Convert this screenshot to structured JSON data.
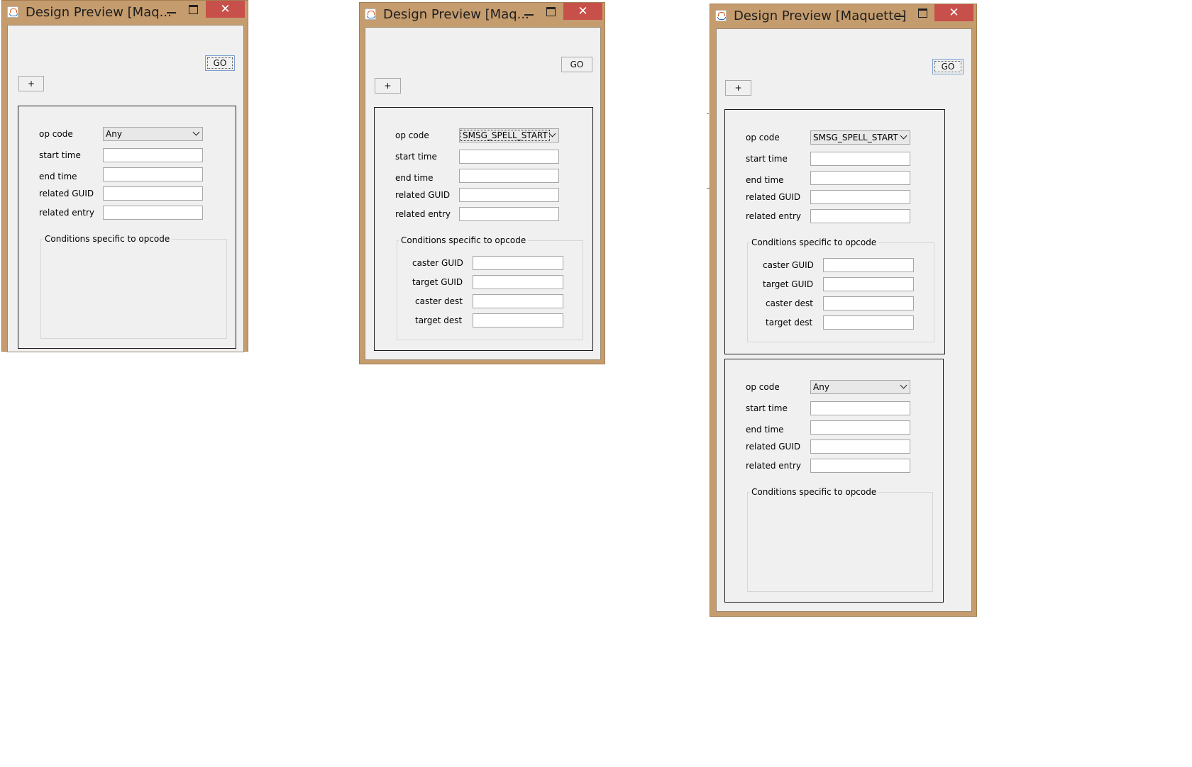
{
  "windows": [
    {
      "title": "Design Preview [Maq...",
      "go_label": "GO",
      "add_label": "+",
      "filters": [
        {
          "op_code_label": "op code",
          "op_code_value": "Any",
          "start_time_label": "start time",
          "end_time_label": "end time",
          "related_guid_label": "related GUID",
          "related_entry_label": "related entry",
          "conditions_title": "Conditions specific to opcode",
          "conditions": []
        }
      ]
    },
    {
      "title": "Design Preview [Maq...",
      "go_label": "GO",
      "add_label": "+",
      "filters": [
        {
          "op_code_label": "op code",
          "op_code_value": "SMSG_SPELL_START",
          "start_time_label": "start time",
          "end_time_label": "end time",
          "related_guid_label": "related GUID",
          "related_entry_label": "related entry",
          "conditions_title": "Conditions specific to opcode",
          "conditions": [
            "caster GUID",
            "target GUID",
            "caster dest",
            "target dest"
          ]
        }
      ]
    },
    {
      "title": "Design Preview [Maquette]",
      "go_label": "GO",
      "add_label": "+",
      "filters": [
        {
          "op_code_label": "op code",
          "op_code_value": "SMSG_SPELL_START",
          "start_time_label": "start time",
          "end_time_label": "end time",
          "related_guid_label": "related GUID",
          "related_entry_label": "related entry",
          "conditions_title": "Conditions specific to opcode",
          "conditions": [
            "caster GUID",
            "target GUID",
            "caster dest",
            "target dest"
          ]
        },
        {
          "op_code_label": "op code",
          "op_code_value": "Any",
          "start_time_label": "start time",
          "end_time_label": "end time",
          "related_guid_label": "related GUID",
          "related_entry_label": "related entry",
          "conditions_title": "Conditions specific to opcode",
          "conditions": []
        }
      ]
    }
  ],
  "controls": {
    "close_glyph": "✕"
  },
  "colors": {
    "frame": "#c59c6e",
    "close": "#c7504a",
    "client": "#f0f0f0"
  }
}
